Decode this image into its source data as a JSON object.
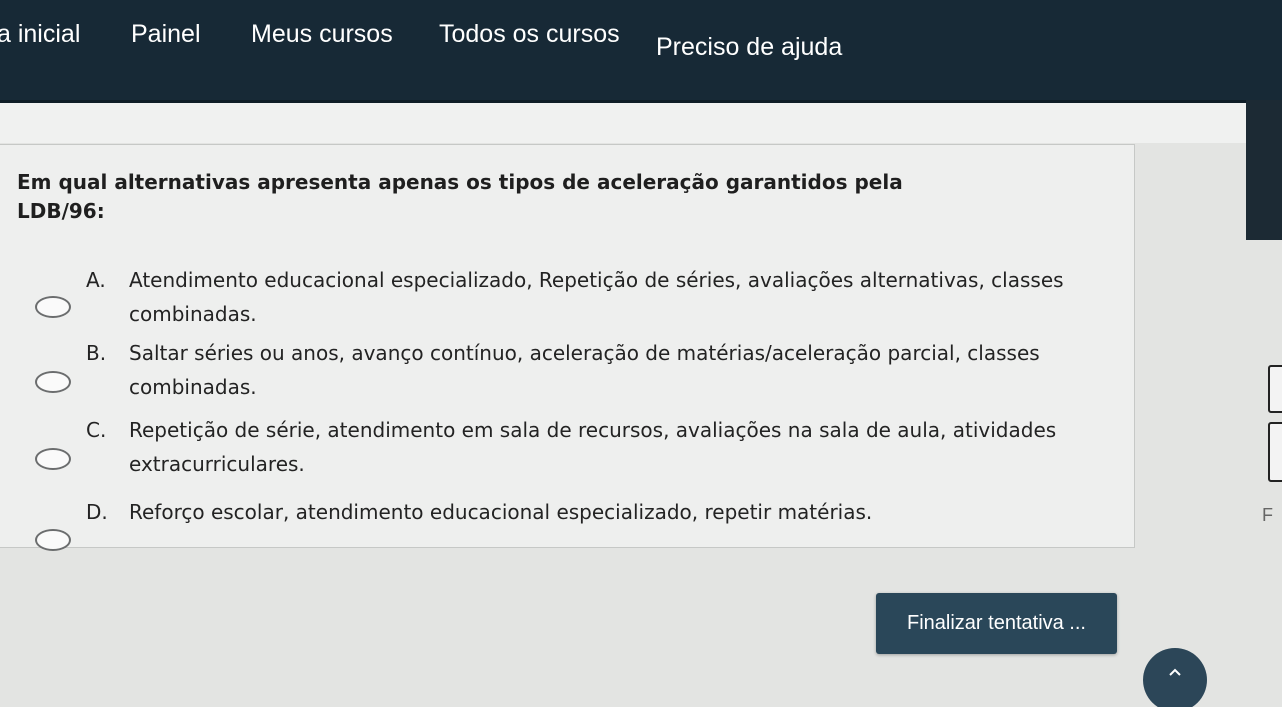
{
  "nav": {
    "home": "a inicial",
    "painel": "Painel",
    "meus_cursos": "Meus cursos",
    "todos_cursos": "Todos os cursos",
    "ajuda": "Preciso de ajuda"
  },
  "question": {
    "text": "Em qual alternativas apresenta apenas os tipos de aceleração garantidos pela LDB/96:",
    "options": [
      {
        "letter": "A.",
        "text": "Atendimento educacional especializado, Repetição de séries, avaliações alternativas, classes combinadas."
      },
      {
        "letter": "B.",
        "text": "Saltar séries ou anos, avanço contínuo, aceleração de matérias/aceleração parcial, classes combinadas."
      },
      {
        "letter": "C.",
        "text": "Repetição de série, atendimento em sala de recursos, avaliações na sala de aula, atividades extracurriculares."
      },
      {
        "letter": "D.",
        "text": "Reforço escolar, atendimento educacional especializado, repetir matérias."
      }
    ]
  },
  "side": {
    "partial_label": "F"
  },
  "actions": {
    "finish": "Finalizar tentativa ..."
  },
  "icons": {
    "scroll_top": "chevron-up-icon",
    "radio": "radio-unchecked-icon"
  },
  "colors": {
    "navbar": "#172936",
    "button": "#2a4759",
    "card": "#eeefee"
  }
}
